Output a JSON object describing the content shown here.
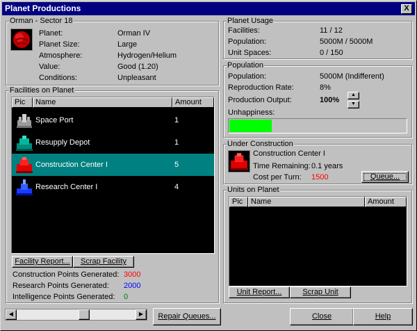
{
  "window": {
    "title": "Planet Productions",
    "close_glyph": "X"
  },
  "planet": {
    "group_title": "Orman - Sector 18",
    "icon": "planet-icon",
    "fields": [
      {
        "label": "Planet:",
        "value": "Orman IV"
      },
      {
        "label": "Planet Size:",
        "value": "Large"
      },
      {
        "label": "Atmosphere:",
        "value": "Hydrogen/Helium"
      },
      {
        "label": "Value:",
        "value": "Good  (1.20)"
      },
      {
        "label": "Conditions:",
        "value": "Unpleasant"
      }
    ]
  },
  "usage": {
    "group_title": "Planet Usage",
    "fields": [
      {
        "label": "Facilities:",
        "value": "11 / 12"
      },
      {
        "label": "Population:",
        "value": "5000M / 5000M"
      },
      {
        "label": "Unit Spaces:",
        "value": "0 / 150"
      }
    ]
  },
  "population": {
    "group_title": "Population",
    "population_label": "Population:",
    "population_value": "5000M  (Indifferent)",
    "reproduction_label": "Reproduction Rate:",
    "reproduction_value": "8%",
    "production_label": "Production Output:",
    "production_value": "100%",
    "unhappiness_label": "Unhappiness:",
    "unhappiness_fraction": 0.24,
    "unhappiness_color": "#00ff00"
  },
  "facilities": {
    "group_title": "Facilities on Planet",
    "columns": {
      "pic": "Pic",
      "name": "Name",
      "amount": "Amount"
    },
    "rows": [
      {
        "name": "Space Port",
        "amount": "1",
        "icon": "space-port-icon",
        "selected": false
      },
      {
        "name": "Resupply Depot",
        "amount": "1",
        "icon": "resupply-depot-icon",
        "selected": false
      },
      {
        "name": "Construction Center I",
        "amount": "5",
        "icon": "construction-center-icon",
        "selected": true
      },
      {
        "name": "Research Center I",
        "amount": "4",
        "icon": "research-center-icon",
        "selected": false
      }
    ],
    "report_button": "Facility Report...",
    "scrap_button": "Scrap Facility"
  },
  "points": {
    "construction_label": "Construction Points Generated:",
    "construction_value": "3000",
    "research_label": "Research Points Generated:",
    "research_value": "2000",
    "intelligence_label": "Intelligence Points Generated:",
    "intelligence_value": "0"
  },
  "under_construction": {
    "group_title": "Under Construction",
    "item_name": "Construction Center I",
    "time_label": "Time Remaining:",
    "time_value": "0.1 years",
    "cost_label": "Cost per Turn:",
    "cost_value": "1500",
    "queue_button": "Queue..."
  },
  "units": {
    "group_title": "Units on Planet",
    "columns": {
      "pic": "Pic",
      "name": "Name",
      "amount": "Amount"
    },
    "report_button": "Unit Report...",
    "scrap_button": "Scrap Unit"
  },
  "footer": {
    "repair_button": "Repair Queues...",
    "close_button": "Close",
    "help_button": "Help",
    "scroll_left_glyph": "◀",
    "scroll_right_glyph": "▶",
    "spinner_up_glyph": "▲",
    "spinner_down_glyph": "▼"
  },
  "colors": {
    "title_bar": "#000080",
    "selection": "#008080",
    "construction_points": "#ff0000",
    "research_points": "#0000ff",
    "intelligence_points": "#008000",
    "cost": "#ff0000"
  }
}
